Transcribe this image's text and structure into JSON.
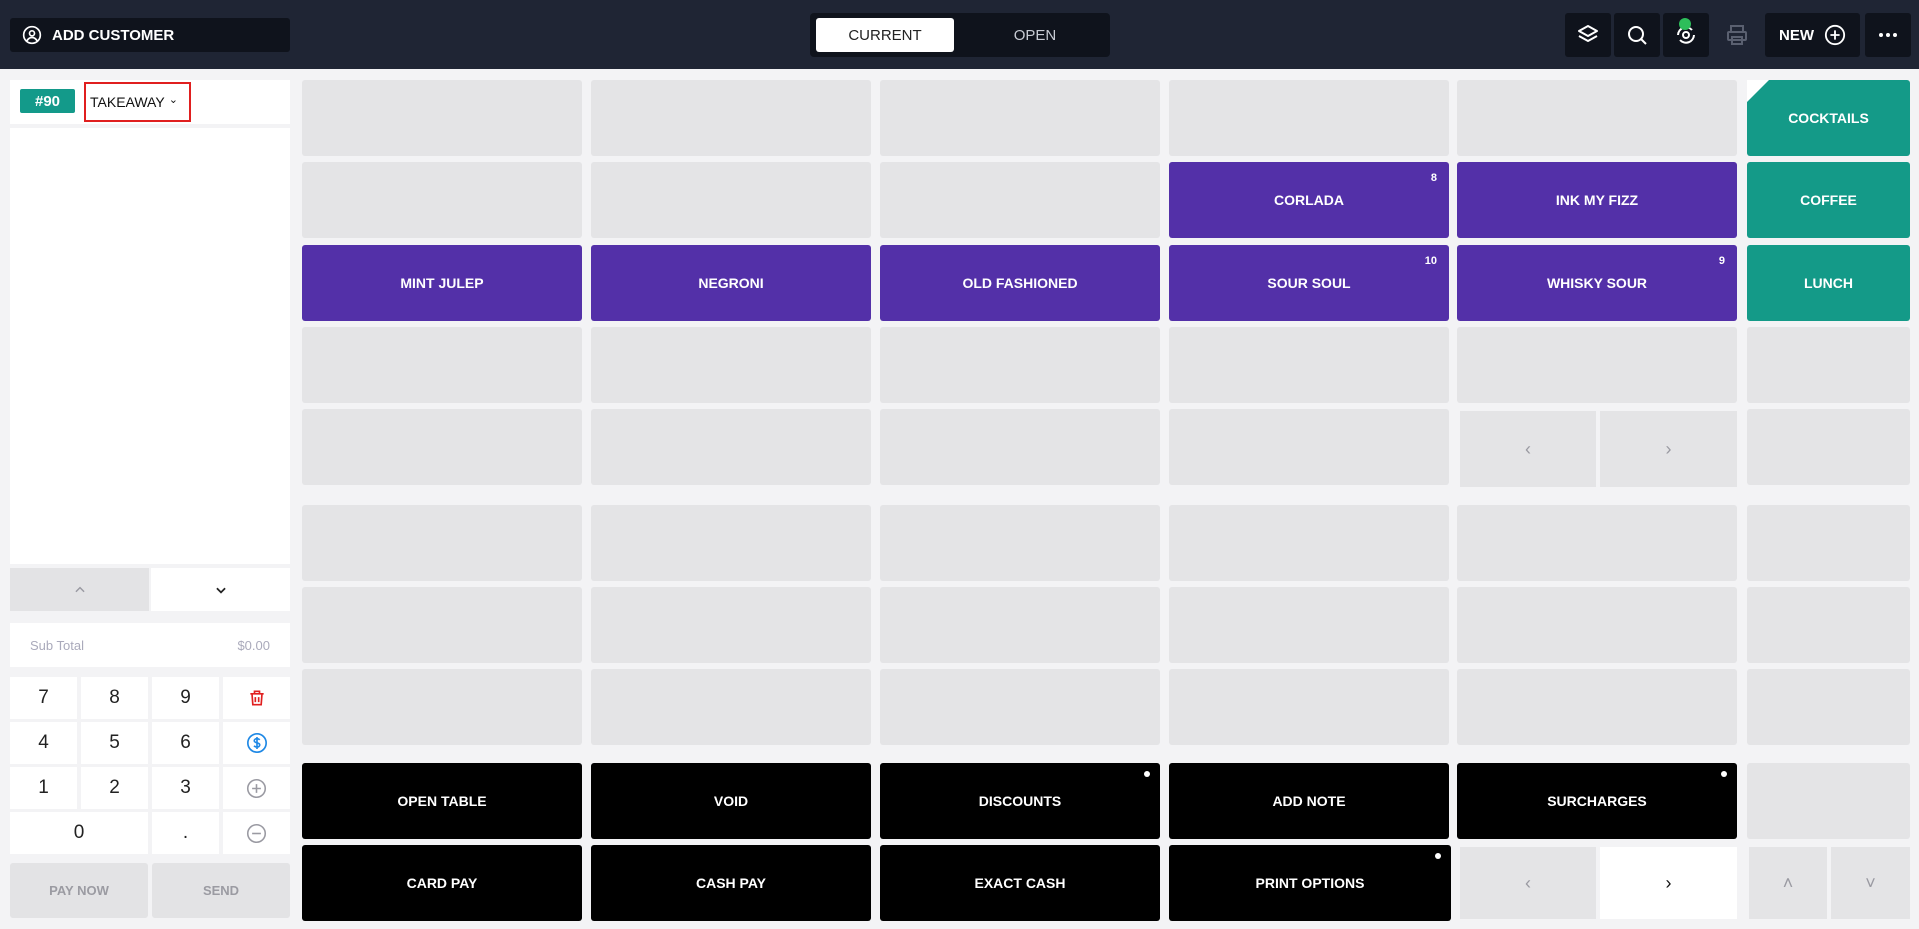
{
  "topbar": {
    "add_customer": "ADD CUSTOMER",
    "seg_current": "CURRENT",
    "seg_open": "OPEN",
    "new_label": "NEW"
  },
  "order": {
    "number": "#90",
    "type": "TAKEAWAY",
    "subtotal_label": "Sub Total",
    "subtotal_value": "$0.00"
  },
  "keypad": {
    "k7": "7",
    "k8": "8",
    "k9": "9",
    "k4": "4",
    "k5": "5",
    "k6": "6",
    "k1": "1",
    "k2": "2",
    "k3": "3",
    "k0": "0",
    "kdot": ".",
    "pay_now": "PAY NOW",
    "send": "SEND"
  },
  "products": {
    "corlada": "CORLADA",
    "corlada_badge": "8",
    "ink_my_fizz": "INK MY FIZZ",
    "mint_julep": "MINT JULEP",
    "negroni": "NEGRONI",
    "old_fashioned": "OLD FASHIONED",
    "sour_soul": "SOUR SOUL",
    "sour_soul_badge": "10",
    "whisky_sour": "WHISKY SOUR",
    "whisky_sour_badge": "9"
  },
  "categories": {
    "cocktails": "COCKTAILS",
    "coffee": "COFFEE",
    "lunch": "LUNCH"
  },
  "actions": {
    "open_table": "OPEN TABLE",
    "void": "VOID",
    "discounts": "DISCOUNTS",
    "add_note": "ADD NOTE",
    "surcharges": "SURCHARGES",
    "card_pay": "CARD PAY",
    "cash_pay": "CASH PAY",
    "exact_cash": "EXACT CASH",
    "print_options": "PRINT OPTIONS"
  },
  "glyphs": {
    "left": "‹",
    "right": "›",
    "up": "˄",
    "down": "˅",
    "caret": "⌄"
  },
  "colors": {
    "topbar": "#1f2534",
    "product_purple": "#5330a8",
    "category_teal": "#149a88",
    "action_black": "#000000",
    "highlight_red": "#e01f1f"
  }
}
